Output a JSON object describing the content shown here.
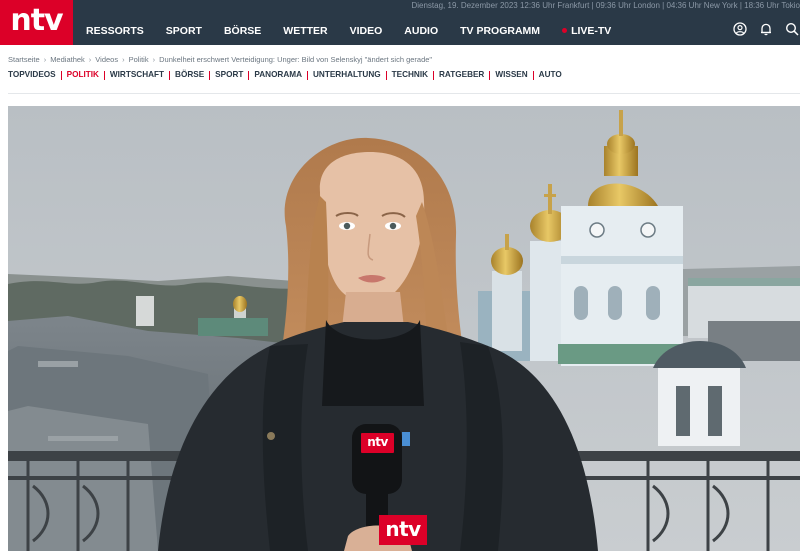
{
  "header": {
    "logo_text": "ntv",
    "date_line": "Dienstag, 19. Dezember 2023 12:36 Uhr Frankfurt | 09:36 Uhr London | 04:36 Uhr New York | 18:36 Uhr Tokio",
    "nav_items": [
      {
        "label": "RESSORTS"
      },
      {
        "label": "SPORT"
      },
      {
        "label": "BÖRSE"
      },
      {
        "label": "WETTER"
      },
      {
        "label": "VIDEO"
      },
      {
        "label": "AUDIO"
      },
      {
        "label": "TV PROGRAMM"
      },
      {
        "label": "LIVE-TV"
      }
    ],
    "icons": [
      "user-icon",
      "bell-icon",
      "search-icon"
    ],
    "colors": {
      "bar": "#2a3947",
      "brand": "#dc0028"
    }
  },
  "breadcrumb": [
    "Startseite",
    "Mediathek",
    "Videos",
    "Politik",
    "Dunkelheit erschwert Verteidigung: Unger: Bild von Selenskyj \"ändert sich gerade\""
  ],
  "section_nav": {
    "items": [
      "TOPVIDEOS",
      "POLITIK",
      "WIRTSCHAFT",
      "BÖRSE",
      "SPORT",
      "PANORAMA",
      "UNTERHALTUNG",
      "TECHNIK",
      "RATGEBER",
      "WISSEN",
      "AUTO"
    ],
    "active": "POLITIK"
  },
  "video": {
    "mic_flag_text": "ntv",
    "watermark_text": "ntv"
  }
}
